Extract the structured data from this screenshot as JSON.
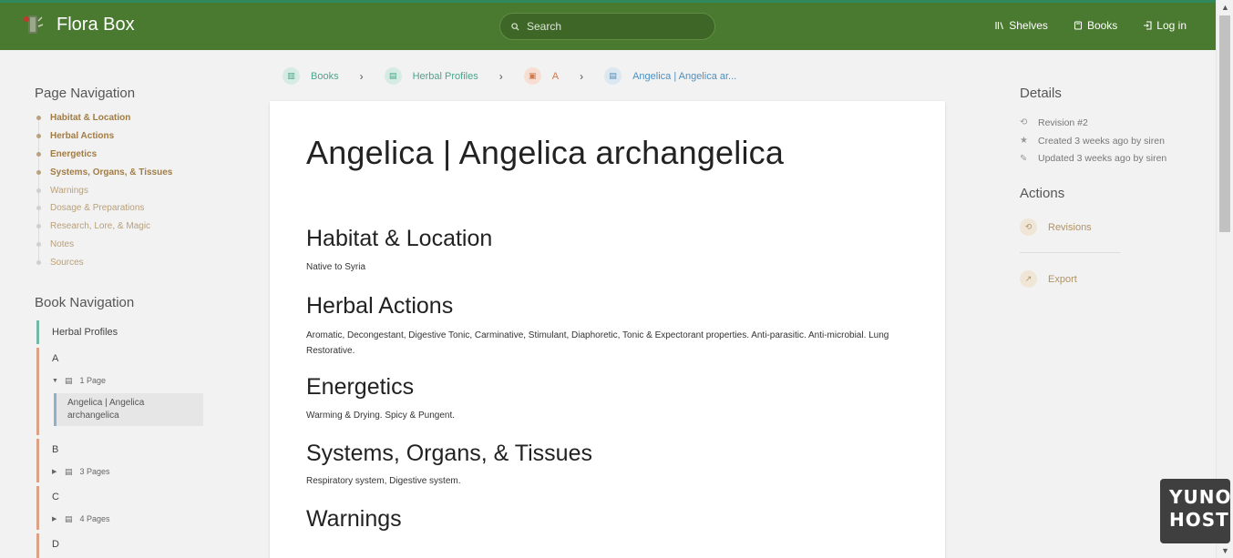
{
  "header": {
    "brand": "Flora Box",
    "search_placeholder": "Search",
    "nav": [
      {
        "label": "Shelves",
        "icon": "shelves-icon"
      },
      {
        "label": "Books",
        "icon": "book-icon"
      },
      {
        "label": "Log in",
        "icon": "login-icon"
      }
    ]
  },
  "page_nav": {
    "title": "Page Navigation",
    "items": [
      {
        "label": "Habitat & Location",
        "bold": true
      },
      {
        "label": "Herbal Actions",
        "bold": true
      },
      {
        "label": "Energetics",
        "bold": true
      },
      {
        "label": "Systems, Organs, & Tissues",
        "bold": true
      },
      {
        "label": "Warnings",
        "bold": false
      },
      {
        "label": "Dosage & Preparations",
        "bold": false
      },
      {
        "label": "Research, Lore, & Magic",
        "bold": false
      },
      {
        "label": "Notes",
        "bold": false
      },
      {
        "label": "Sources",
        "bold": false
      }
    ]
  },
  "book_nav": {
    "title": "Book Navigation",
    "book": "Herbal Profiles",
    "chapters": [
      {
        "name": "A",
        "count": "1 Page",
        "expanded": true,
        "pages": [
          "Angelica | Angelica archangelica"
        ]
      },
      {
        "name": "B",
        "count": "3 Pages",
        "expanded": false
      },
      {
        "name": "C",
        "count": "4 Pages",
        "expanded": false
      },
      {
        "name": "D",
        "count": "",
        "expanded": false
      }
    ]
  },
  "breadcrumb": [
    {
      "label": "Books",
      "color": "#4aa58b",
      "bg": "#d6ebe4"
    },
    {
      "label": "Herbal Profiles",
      "color": "#4aa58b",
      "bg": "#d6ebe4"
    },
    {
      "label": "A",
      "color": "#d07a4e",
      "bg": "#f6dfd2"
    },
    {
      "label": "Angelica | Angelica ar...",
      "color": "#4e8fbd",
      "bg": "#dbe7f1"
    }
  ],
  "content": {
    "title": "Angelica | Angelica archangelica",
    "sections": [
      {
        "heading": "Habitat & Location",
        "text": "Native to Syria"
      },
      {
        "heading": "Herbal Actions",
        "text": "Aromatic, Decongestant, Digestive Tonic, Carminative, Stimulant, Diaphoretic, Tonic & Expectorant properties. Anti-parasitic. Anti-microbial. Lung Restorative."
      },
      {
        "heading": "Energetics",
        "text": "Warming & Drying. Spicy & Pungent."
      },
      {
        "heading": "Systems, Organs, & Tissues",
        "text": " Respiratory system, Digestive system."
      },
      {
        "heading": "Warnings",
        "text": ""
      }
    ]
  },
  "details": {
    "title": "Details",
    "revision": "Revision #2",
    "created": "Created 3 weeks ago by siren",
    "updated": "Updated 3 weeks ago by siren"
  },
  "actions": {
    "title": "Actions",
    "revisions": "Revisions",
    "export": "Export"
  },
  "yunohost": {
    "line1": "YUNO",
    "line2": "HOST"
  },
  "colors": {
    "header": "#4a7a2f",
    "accent": "#b09365"
  }
}
